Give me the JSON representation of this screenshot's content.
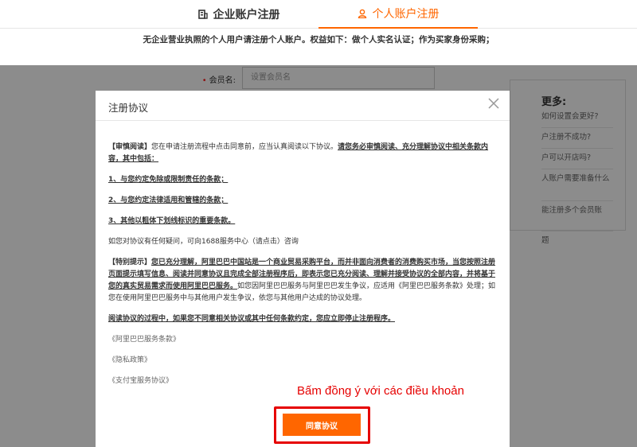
{
  "tabs": {
    "enterprise": "企业账户注册",
    "personal": "个人账户注册"
  },
  "notice": "无企业营业执照的个人用户请注册个人账户。权益如下：做个人实名认证；作为买家身份采购；",
  "form": {
    "member_name_label": "会员名:",
    "member_name_placeholder": "设置会员名"
  },
  "help": {
    "title": "更多:",
    "items": [
      "如何设置会更好?",
      "户注册不成功?",
      "户可以开店吗?",
      "人账户需要准备什么",
      "能注册多个会员账",
      "题"
    ]
  },
  "dialog": {
    "title": "注册协议",
    "p1_label": "【审慎阅读】",
    "p1_text": "您在申请注册流程中点击同意前，应当认真阅读以下协议。",
    "p1_underline": "请您务必审慎阅读、充分理解协议中相关条款内容，其中包括：",
    "item1": "1、与您约定免除或限制责任的条款；",
    "item2": "2、与您约定法律适用和管辖的条款；",
    "item3": "3、其他以粗体下划线标识的重要条款。",
    "contact": "如您对协议有任何疑问，可向1688服务中心（请点击）咨询",
    "p2_label": "【特别提示】",
    "p2_underline": "您已充分理解，阿里巴巴中国站是一个商业贸易采购平台，而并非面向消费者的消费购买市场，当您按照注册页面提示填写信息、阅读并同意协议且完成全部注册程序后，即表示您已充分阅读、理解并接受协议的全部内容，并将基于您的真实贸易需求而使用阿里巴巴服务。",
    "p2_text": "如您因阿里巴巴服务与阿里巴巴发生争议，应适用《阿里巴巴服务条款》处理；如您在使用阿里巴巴服务中与其他用户发生争议，依您与其他用户达成的协议处理。",
    "p3_underline": "阅读协议的过程中，如果您不同意相关协议或其中任何条款约定，您应立即停止注册程序。",
    "links": [
      "《阿里巴巴服务条款》",
      "《隐私政策》",
      "《支付宝服务协议》"
    ],
    "agree_button": "同意协议"
  },
  "annotation": "Bấm đồng ý với các điều khoản",
  "colors": {
    "accent": "#ff6600",
    "annotation": "#e60000"
  }
}
